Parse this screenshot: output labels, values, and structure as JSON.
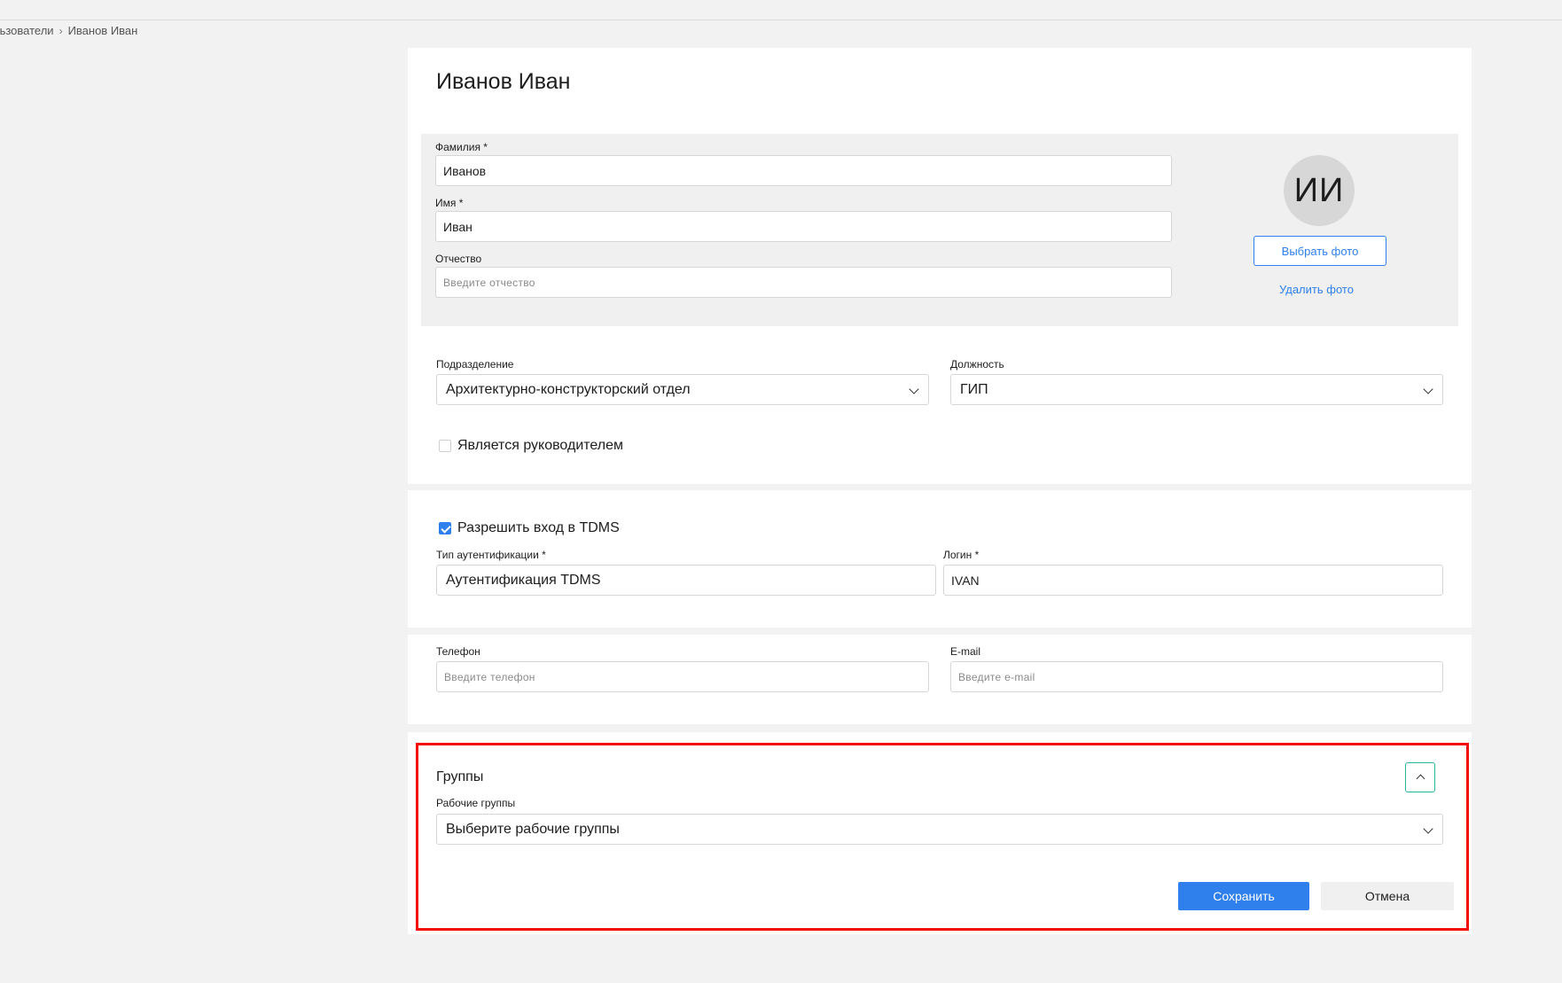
{
  "breadcrumb": {
    "parent": "льзователи",
    "current": "Иванов Иван",
    "separator": "›"
  },
  "title": "Иванов Иван",
  "name_panel": {
    "last_name_label": "Фамилия *",
    "last_name_value": "Иванов",
    "first_name_label": "Имя *",
    "first_name_value": "Иван",
    "patronymic_label": "Отчество",
    "patronymic_placeholder": "Введите отчество"
  },
  "photo": {
    "initials": "ИИ",
    "choose_label": "Выбрать фото",
    "delete_label": "Удалить фото"
  },
  "org": {
    "division_label": "Подразделение",
    "division_value": "Архитектурно-конструкторский отдел",
    "position_label": "Должность",
    "position_value": "ГИП",
    "is_manager_label": "Является руководителем",
    "is_manager_checked": false
  },
  "access": {
    "allow_login_label": "Разрешить вход в TDMS",
    "allow_login_checked": true,
    "auth_type_label": "Тип аутентификации *",
    "auth_type_value": "Аутентификация TDMS",
    "login_label": "Логин *",
    "login_value": "IVAN"
  },
  "contacts": {
    "phone_label": "Телефон",
    "phone_placeholder": "Введите телефон",
    "email_label": "E-mail",
    "email_placeholder": "Введите e-mail"
  },
  "groups": {
    "title": "Группы",
    "work_groups_label": "Рабочие группы",
    "work_groups_placeholder": "Выберите рабочие группы"
  },
  "actions": {
    "save_label": "Сохранить",
    "cancel_label": "Отмена"
  },
  "colors": {
    "accent": "#2f80ed",
    "highlight": "#f20d0d",
    "panel": "#f0f0f0",
    "background": "#f2f2f2"
  },
  "icons": {
    "dropdown": "chevron-down-icon",
    "collapse": "chevron-up-icon",
    "breadcrumb_sep": "chevron-right-icon"
  }
}
